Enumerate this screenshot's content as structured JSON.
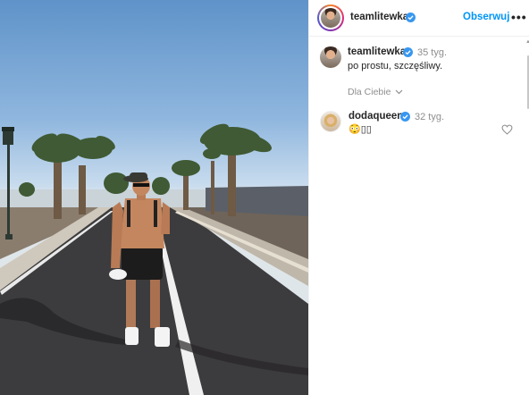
{
  "post": {
    "author": "teamlitewka",
    "follow_label": "Obserwuj",
    "more_label": "•••",
    "caption_author": "teamlitewka",
    "caption_time": "35 tyg.",
    "caption_text": "po prostu, szczęśliwy.",
    "for_you_label": "Dla Ciebie",
    "for_you_chevron": "chevron-down-icon"
  },
  "comments": [
    {
      "author": "dodaqueen",
      "time": "32 tyg.",
      "text": "😳▯▯"
    }
  ],
  "colors": {
    "verified": "#3897f0",
    "link": "#0095f6",
    "muted": "#8e8e8e",
    "text": "#262626"
  },
  "icons": [
    "verified-badge-icon",
    "more-icon",
    "chevron-down-icon",
    "heart-icon"
  ]
}
